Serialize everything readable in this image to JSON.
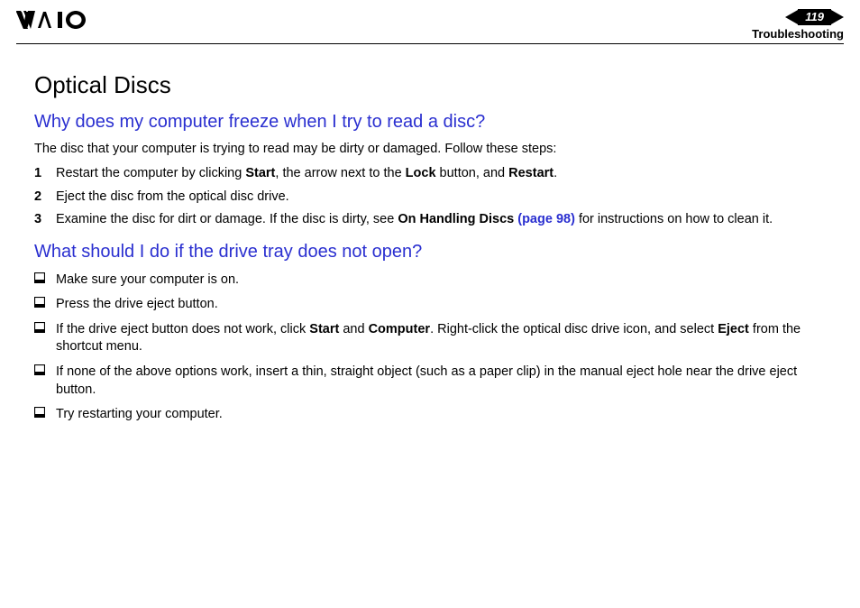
{
  "header": {
    "page_number": "119",
    "section": "Troubleshooting"
  },
  "title": "Optical Discs",
  "q1": {
    "heading": "Why does my computer freeze when I try to read a disc?",
    "intro": "The disc that your computer is trying to read may be dirty or damaged. Follow these steps:",
    "steps": [
      {
        "num": "1",
        "pre": "Restart the computer by clicking ",
        "b1": "Start",
        "mid1": ", the arrow next to the ",
        "b2": "Lock",
        "mid2": " button, and ",
        "b3": "Restart",
        "post": "."
      },
      {
        "num": "2",
        "text": "Eject the disc from the optical disc drive."
      },
      {
        "num": "3",
        "pre": "Examine the disc for dirt or damage. If the disc is dirty, see ",
        "b1": "On Handling Discs ",
        "link": "(page 98)",
        "post": " for instructions on how to clean it."
      }
    ]
  },
  "q2": {
    "heading": "What should I do if the drive tray does not open?",
    "items": [
      {
        "text": "Make sure your computer is on."
      },
      {
        "text": "Press the drive eject button."
      },
      {
        "pre": "If the drive eject button does not work, click ",
        "b1": "Start",
        "mid1": " and ",
        "b2": "Computer",
        "mid2": ". Right-click the optical disc drive icon, and select ",
        "b3": "Eject",
        "post": " from the shortcut menu."
      },
      {
        "text": "If none of the above options work, insert a thin, straight object (such as a paper clip) in the manual eject hole near the drive eject button."
      },
      {
        "text": "Try restarting your computer."
      }
    ]
  }
}
